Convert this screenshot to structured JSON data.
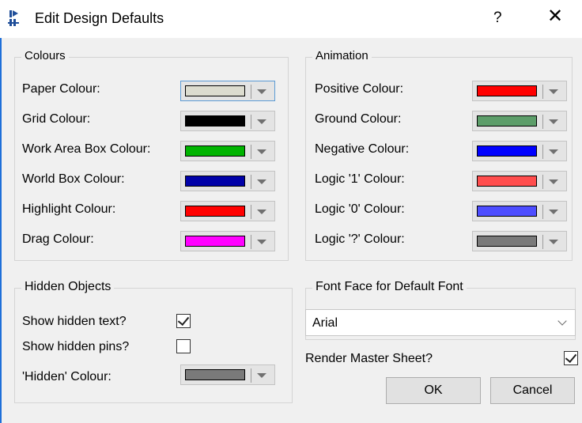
{
  "window": {
    "title": "Edit Design Defaults",
    "help_label": "?",
    "close_label": "✕"
  },
  "colours": {
    "title": "Colours",
    "rows": [
      {
        "label": "Paper Colour:",
        "color": "#dcdccf"
      },
      {
        "label": "Grid Colour:",
        "color": "#000000"
      },
      {
        "label": "Work Area Box Colour:",
        "color": "#00b400"
      },
      {
        "label": "World Box Colour:",
        "color": "#0000a8"
      },
      {
        "label": "Highlight Colour:",
        "color": "#ff0000"
      },
      {
        "label": "Drag Colour:",
        "color": "#ff00ff"
      }
    ]
  },
  "animation": {
    "title": "Animation",
    "rows": [
      {
        "label": "Positive Colour:",
        "color": "#ff0000"
      },
      {
        "label": "Ground Colour:",
        "color": "#5d9e6a"
      },
      {
        "label": "Negative Colour:",
        "color": "#0000ff"
      },
      {
        "label": "Logic '1' Colour:",
        "color": "#ff4d4d"
      },
      {
        "label": "Logic '0' Colour:",
        "color": "#4d4dff"
      },
      {
        "label": "Logic '?' Colour:",
        "color": "#7a7a7a"
      }
    ]
  },
  "hidden_objects": {
    "title": "Hidden Objects",
    "show_text_label": "Show hidden text?",
    "show_text_checked": true,
    "show_pins_label": "Show hidden pins?",
    "show_pins_checked": false,
    "hidden_colour_label": "'Hidden' Colour:",
    "hidden_colour": "#7a7a7a"
  },
  "font_face": {
    "title": "Font Face for Default Font",
    "value": "Arial"
  },
  "render_master": {
    "label": "Render Master Sheet?",
    "checked": true
  },
  "buttons": {
    "ok": "OK",
    "cancel": "Cancel"
  }
}
